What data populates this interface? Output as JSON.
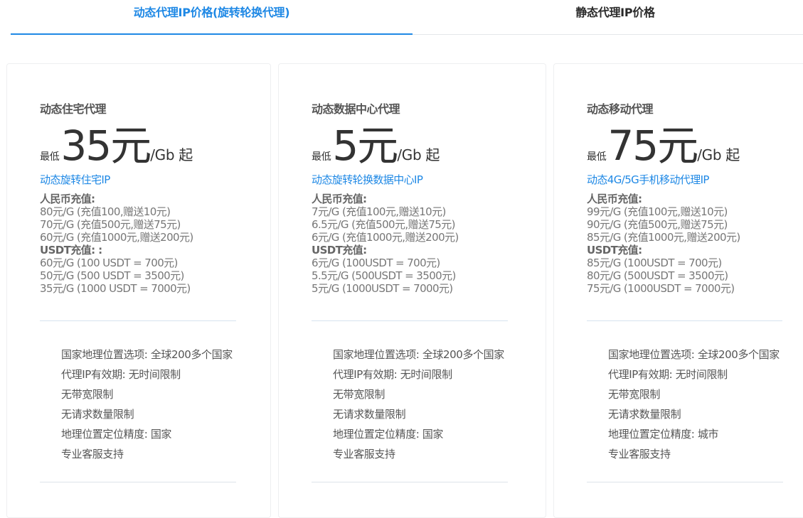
{
  "tabs": [
    {
      "label": "动态代理IP价格(旋转轮换代理)",
      "active": true
    },
    {
      "label": "静态代理IP价格",
      "active": false
    }
  ],
  "accent_color": "#1e88e5",
  "cards": [
    {
      "title": "动态住宅代理",
      "price_prefix": "最低",
      "price": "35元",
      "price_unit": "/Gb 起",
      "subtitle": "动态旋转住宅IP",
      "rmb_header": "人民币充值:",
      "rmb": [
        "80元/G (充值100,赠送10元)",
        "70元/G (充值500元,赠送75元)",
        "60元/G (充值1000元,赠送200元)"
      ],
      "usdt_header": "USDT充值: :",
      "usdt": [
        "60元/G (100 USDT = 700元)",
        "50元/G (500 USDT = 3500元)",
        "35元/G (1000 USDT = 7000元)"
      ],
      "features": [
        "国家地理位置选项: 全球200多个国家",
        "代理IP有效期: 无时间限制",
        "无带宽限制",
        "无请求数量限制",
        "地理位置定位精度: 国家",
        "专业客服支持"
      ]
    },
    {
      "title": "动态数据中心代理",
      "price_prefix": "最低",
      "price": "5元",
      "price_unit": "/Gb 起",
      "subtitle": "动态旋转轮换数据中心IP",
      "rmb_header": "人民币充值:",
      "rmb": [
        "7元/G (充值100元,赠送10元)",
        "6.5元/G (充值500元,赠送75元)",
        "6元/G (充值1000元,赠送200元)"
      ],
      "usdt_header": "USDT充值:",
      "usdt": [
        "6元/G (100USDT = 700元)",
        "5.5元/G (500USDT = 3500元)",
        "5元/G (1000USDT = 7000元)"
      ],
      "features": [
        "国家地理位置选项: 全球200多个国家",
        "代理IP有效期: 无时间限制",
        "无带宽限制",
        "无请求数量限制",
        "地理位置定位精度: 国家",
        "专业客服支持"
      ]
    },
    {
      "title": "动态移动代理",
      "price_prefix": "最低",
      "price": "75元",
      "price_unit": "/Gb 起",
      "subtitle": "动态4G/5G手机移动代理IP",
      "rmb_header": "人民币充值:",
      "rmb": [
        "99元/G (充值100元,赠送10元)",
        "90元/G (充值500元,赠送75元)",
        "85元/G (充值1000元,赠送200元)"
      ],
      "usdt_header": "USDT充值:",
      "usdt": [
        "85元/G (100USDT = 700元)",
        "80元/G (500USDT = 3500元)",
        "75元/G (1000USDT = 7000元)"
      ],
      "features": [
        "国家地理位置选项: 全球200多个国家",
        "代理IP有效期: 无时间限制",
        "无带宽限制",
        "无请求数量限制",
        "地理位置定位精度: 城市",
        "专业客服支持"
      ]
    }
  ]
}
